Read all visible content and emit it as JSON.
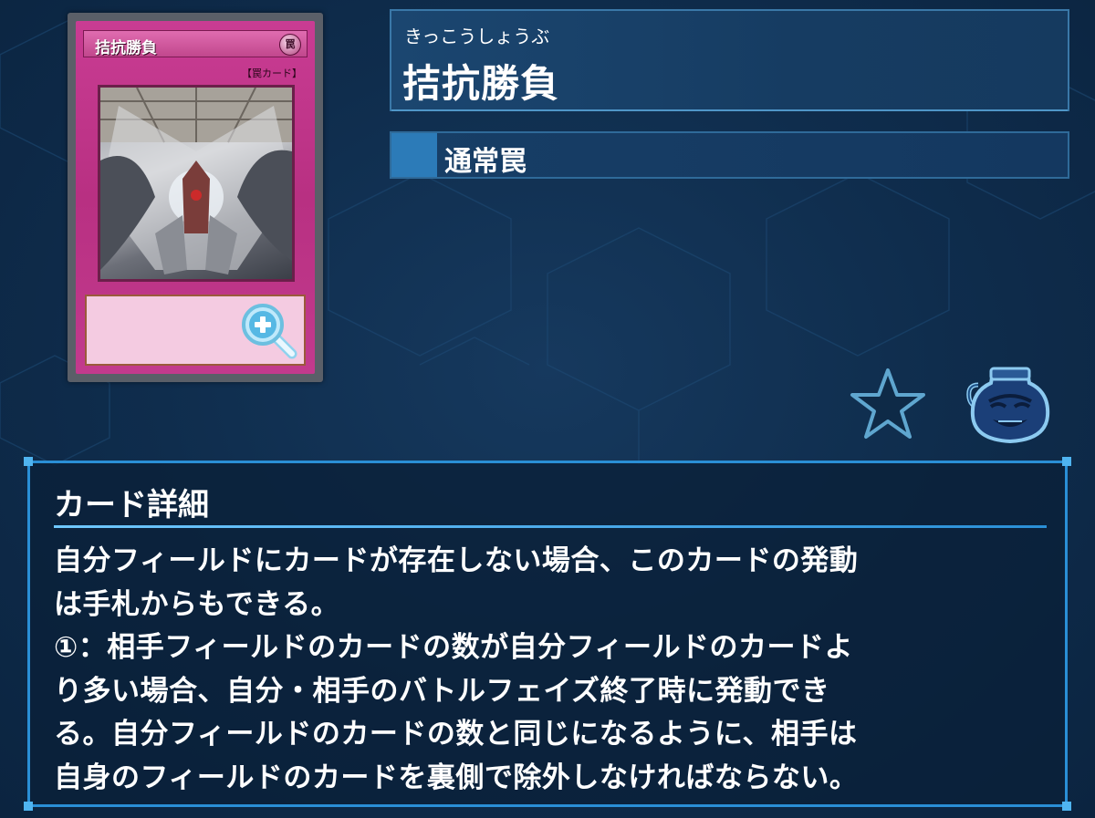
{
  "card": {
    "name_ruby": "きっこうしょうぶ",
    "name": "拮抗勝負",
    "type": "通常罠",
    "image": {
      "name_text": "拮抗勝負",
      "attribute_glyph": "罠",
      "type_line": "【罠カード】"
    }
  },
  "icons": {
    "zoom": "zoom-in-icon",
    "favorite": "star-icon",
    "pot": "pot-of-greed-icon"
  },
  "details": {
    "title": "カード詳細",
    "lines": [
      "自分フィールドにカードが存在しない場合、このカードの発動",
      "は手札からもできる。",
      "①：相手フィールドのカードの数が自分フィールドのカードよ",
      "り多い場合、自分・相手のバトルフェイズ終了時に発動でき",
      "る。自分フィールドのカードの数と同じになるように、相手は",
      "自身のフィールドのカードを裏側で除外しなければならない。"
    ]
  },
  "colors": {
    "background": "#0e2947",
    "panel_border": "#2a8fd6",
    "trap_card": "#c23a8d",
    "type_accent": "#2c7bb8"
  }
}
